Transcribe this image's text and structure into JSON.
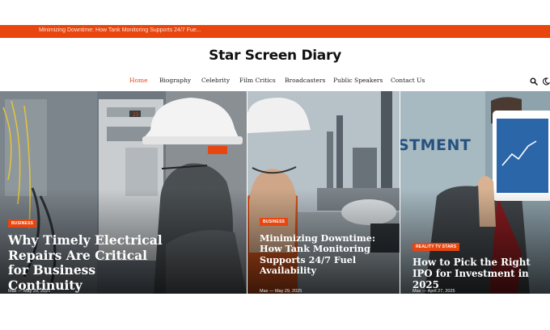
{
  "ticker": {
    "text": "Minimizing Downtime: How Tank Monitoring Supports 24/7 Fue..."
  },
  "site": {
    "title": "Star Screen Diary"
  },
  "nav": {
    "items": [
      {
        "label": "Home",
        "active": true
      },
      {
        "label": "Biography"
      },
      {
        "label": "Celebrity"
      },
      {
        "label": "Film Critics"
      },
      {
        "label": "Broadcasters"
      },
      {
        "label": "Public Speakers"
      },
      {
        "label": "Contact Us"
      }
    ],
    "icons": [
      "search-icon",
      "theme-toggle-icon"
    ]
  },
  "posts": [
    {
      "category": "Business",
      "title": "Why Timely Electrical Repairs Are Critical for Business Continuity",
      "author": "Max",
      "date": "May 29, 2025"
    },
    {
      "category": "Business",
      "title": "Minimizing Downtime: How Tank Monitoring Supports 24/7 Fuel Availability",
      "author": "Max",
      "date": "May 29, 2025"
    },
    {
      "category": "Reality TV Stars",
      "title": "How to Pick the Right IPO for Investment in 2025",
      "author": "Max",
      "date": "April 27, 2025"
    }
  ],
  "post3_image_text": "STMENT",
  "colors": {
    "accent": "#e8450f"
  }
}
